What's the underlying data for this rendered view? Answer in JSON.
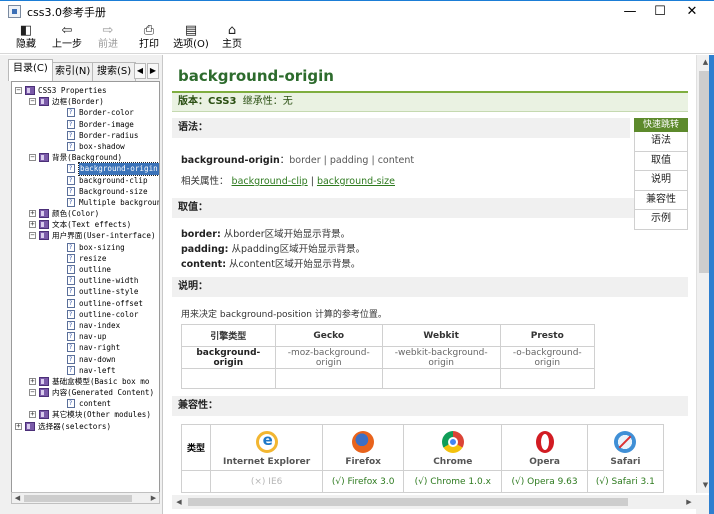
{
  "window": {
    "title": "css3.0参考手册",
    "minimize": "—",
    "maximize": "☐",
    "close": "✕"
  },
  "toolbar": {
    "hide": "隐藏",
    "back": "上一步",
    "forward": "前进",
    "print": "打印",
    "options": "选项(O)",
    "home": "主页"
  },
  "left_tabs": {
    "contents": "目录(C)",
    "index": "索引(N)",
    "search": "搜索(S)"
  },
  "tree": [
    {
      "level": 0,
      "exp": "−",
      "icon": "book",
      "label": "CSS3 Properties"
    },
    {
      "level": 1,
      "exp": "−",
      "icon": "book",
      "label": "边框(Border)"
    },
    {
      "level": 2,
      "exp": "",
      "icon": "page",
      "label": "Border-color"
    },
    {
      "level": 2,
      "exp": "",
      "icon": "page",
      "label": "Border-image"
    },
    {
      "level": 2,
      "exp": "",
      "icon": "page",
      "label": "Border-radius"
    },
    {
      "level": 2,
      "exp": "",
      "icon": "page",
      "label": "box-shadow"
    },
    {
      "level": 1,
      "exp": "−",
      "icon": "book",
      "label": "背景(Background)"
    },
    {
      "level": 2,
      "exp": "",
      "icon": "page",
      "label": "background-origin",
      "selected": true
    },
    {
      "level": 2,
      "exp": "",
      "icon": "page",
      "label": "background-clip"
    },
    {
      "level": 2,
      "exp": "",
      "icon": "page",
      "label": "Background-size"
    },
    {
      "level": 2,
      "exp": "",
      "icon": "page",
      "label": "Multiple backgrounds"
    },
    {
      "level": 1,
      "exp": "+",
      "icon": "book",
      "label": "颜色(Color)"
    },
    {
      "level": 1,
      "exp": "+",
      "icon": "book",
      "label": "文本(Text effects)"
    },
    {
      "level": 1,
      "exp": "−",
      "icon": "book",
      "label": "用户界面(User-interface)"
    },
    {
      "level": 2,
      "exp": "",
      "icon": "page",
      "label": "box-sizing"
    },
    {
      "level": 2,
      "exp": "",
      "icon": "page",
      "label": "resize"
    },
    {
      "level": 2,
      "exp": "",
      "icon": "page",
      "label": "outline"
    },
    {
      "level": 2,
      "exp": "",
      "icon": "page",
      "label": "outline-width"
    },
    {
      "level": 2,
      "exp": "",
      "icon": "page",
      "label": "outline-style"
    },
    {
      "level": 2,
      "exp": "",
      "icon": "page",
      "label": "outline-offset"
    },
    {
      "level": 2,
      "exp": "",
      "icon": "page",
      "label": "outline-color"
    },
    {
      "level": 2,
      "exp": "",
      "icon": "page",
      "label": "nav-index"
    },
    {
      "level": 2,
      "exp": "",
      "icon": "page",
      "label": "nav-up"
    },
    {
      "level": 2,
      "exp": "",
      "icon": "page",
      "label": "nav-right"
    },
    {
      "level": 2,
      "exp": "",
      "icon": "page",
      "label": "nav-down"
    },
    {
      "level": 2,
      "exp": "",
      "icon": "page",
      "label": "nav-left"
    },
    {
      "level": 1,
      "exp": "+",
      "icon": "book",
      "label": "基础盒模型(Basic box mo"
    },
    {
      "level": 1,
      "exp": "−",
      "icon": "book",
      "label": "内容(Generated Content)"
    },
    {
      "level": 2,
      "exp": "",
      "icon": "page",
      "label": "content"
    },
    {
      "level": 1,
      "exp": "+",
      "icon": "book",
      "label": "其它模块(Other modules)"
    },
    {
      "level": 0,
      "exp": "+",
      "icon": "book",
      "label": "选择器(selectors)"
    }
  ],
  "page": {
    "title": "background-origin",
    "version_label": "版本：",
    "version_value": "CSS3",
    "inherit_label": "继承性：",
    "inherit_value": "无",
    "syntax_heading": "语法：",
    "syntax_prop": "background-origin",
    "syntax_sep": "：",
    "syntax_values": "border | padding | content",
    "related_label": "相关属性：",
    "related_1": "background-clip",
    "related_sep": " | ",
    "related_2": "background-size",
    "values_heading": "取值：",
    "value_border_key": "border:",
    "value_border_text": "从border区域开始显示背景。",
    "value_padding_key": "padding:",
    "value_padding_text": "从padding区域开始显示背景。",
    "value_content_key": "content:",
    "value_content_text": "从content区域开始显示背景。",
    "desc_heading": "说明：",
    "desc_text": "用来决定 background-position 计算的参考位置。",
    "compat_heading": "兼容性："
  },
  "quicknav": {
    "head": "快速跳转",
    "items": [
      "语法",
      "取值",
      "说明",
      "兼容性",
      "示例"
    ]
  },
  "engine_table": {
    "headers": [
      "引擎类型",
      "Gecko",
      "Webkit",
      "Presto"
    ],
    "row_label": "background-origin",
    "cells": [
      "-moz-background-origin",
      "-webkit-background-origin",
      "-o-background-origin"
    ]
  },
  "compat_table": {
    "row_header": "类型",
    "browsers": [
      "Internet Explorer",
      "Firefox",
      "Chrome",
      "Opera",
      "Safari"
    ],
    "support": [
      "(×) IE6",
      "(√) Firefox 3.0",
      "(√) Chrome 1.0.x",
      "(√) Opera 9.63",
      "(√) Safari 3.1"
    ]
  },
  "colors": {
    "accent_green": "#2d6b2d",
    "link_green": "#2d7a1e",
    "selection": "#3b73b9"
  }
}
